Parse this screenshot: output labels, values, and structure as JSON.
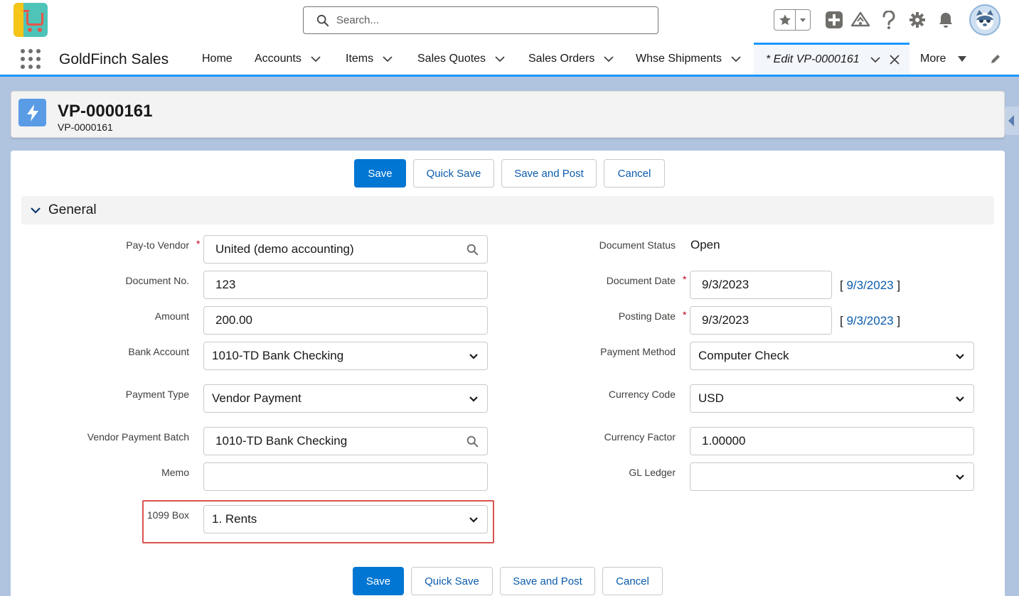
{
  "header": {
    "search_placeholder": "Search...",
    "icons": [
      "favorites-star-icon",
      "favorites-dropdown-icon",
      "global-add-icon",
      "trailhead-icon",
      "help-icon",
      "setup-gear-icon",
      "notifications-bell-icon",
      "user-avatar"
    ]
  },
  "nav": {
    "app_name": "GoldFinch Sales",
    "items": [
      {
        "label": "Home"
      },
      {
        "label": "Accounts"
      },
      {
        "label": "Items"
      },
      {
        "label": "Sales Quotes"
      },
      {
        "label": "Sales Orders"
      },
      {
        "label": "Whse Shipments"
      }
    ],
    "active_tab": "* Edit VP-0000161",
    "more": "More"
  },
  "record": {
    "title": "VP-0000161",
    "subtitle": "VP-0000161"
  },
  "actions": {
    "save": "Save",
    "quick_save": "Quick Save",
    "save_and_post": "Save and Post",
    "cancel": "Cancel"
  },
  "section": {
    "title": "General"
  },
  "fields": {
    "pay_to_vendor": {
      "label": "Pay-to Vendor",
      "value": "United (demo accounting)"
    },
    "document_no": {
      "label": "Document No.",
      "value": "123"
    },
    "amount": {
      "label": "Amount",
      "value": "200.00"
    },
    "bank_account": {
      "label": "Bank Account",
      "value": "1010-TD Bank Checking"
    },
    "payment_type": {
      "label": "Payment Type",
      "value": "Vendor Payment"
    },
    "vendor_payment_batch": {
      "label": "Vendor Payment Batch",
      "value": "1010-TD Bank Checking"
    },
    "memo": {
      "label": "Memo",
      "value": ""
    },
    "box_1099": {
      "label": "1099 Box",
      "value": "1. Rents"
    },
    "document_status": {
      "label": "Document Status",
      "value": "Open"
    },
    "document_date": {
      "label": "Document Date",
      "value": "9/3/2023",
      "link": "9/3/2023"
    },
    "posting_date": {
      "label": "Posting Date",
      "value": "9/3/2023",
      "link": "9/3/2023"
    },
    "payment_method": {
      "label": "Payment Method",
      "value": "Computer Check"
    },
    "currency_code": {
      "label": "Currency Code",
      "value": "USD"
    },
    "currency_factor": {
      "label": "Currency Factor",
      "value": "1.00000"
    },
    "gl_ledger": {
      "label": "GL Ledger",
      "value": ""
    }
  },
  "colors": {
    "brand_blue": "#0176d3",
    "nav_accent": "#1b96ff",
    "required": "#ba0517",
    "highlight": "#d9534f"
  }
}
